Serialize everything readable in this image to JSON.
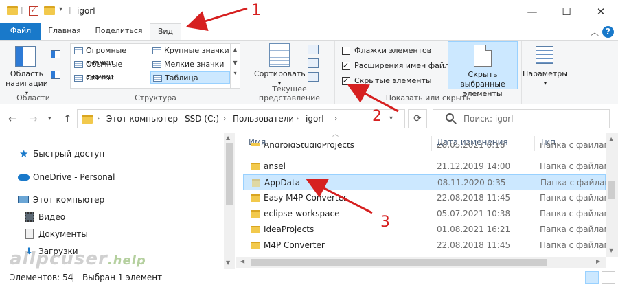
{
  "window": {
    "title": "igorl",
    "minimize": "—",
    "maximize": "☐",
    "close": "✕"
  },
  "tabs": [
    {
      "label": "Файл"
    },
    {
      "label": "Главная"
    },
    {
      "label": "Поделиться"
    },
    {
      "label": "Вид"
    }
  ],
  "help_label": "?",
  "ribbon": {
    "areas": {
      "nav_pane_label_1": "Область",
      "nav_pane_label_2": "навигации",
      "group_label": "Области"
    },
    "layout": {
      "items": [
        "Огромные значки",
        "Крупные значки",
        "Обычные значки",
        "Мелкие значки",
        "Список",
        "Таблица"
      ],
      "selected": "Таблица",
      "group_label": "Структура"
    },
    "current_view": {
      "sort_label": "Сортировать",
      "group_label": "Текущее представление"
    },
    "show_hide": {
      "checkboxes": [
        {
          "label": "Флажки элементов",
          "checked": false
        },
        {
          "label": "Расширения имен файлов",
          "checked": true
        },
        {
          "label": "Скрытые элементы",
          "checked": true
        }
      ],
      "hide_selected_1": "Скрыть выбранные",
      "hide_selected_2": "элементы",
      "group_label": "Показать или скрыть"
    },
    "options_label": "Параметры"
  },
  "address": {
    "crumbs": [
      "Этот компьютер",
      "SSD (C:)",
      "Пользователи",
      "igorl"
    ],
    "search_placeholder": "Поиск: igorl"
  },
  "nav_pane": {
    "items": [
      "Быстрый доступ",
      "OneDrive - Personal",
      "Этот компьютер",
      "Видео",
      "Документы",
      "Загрузки"
    ]
  },
  "file_list": {
    "columns": {
      "name": "Имя",
      "date": "Дата изменения",
      "type": "Тип"
    },
    "rows": [
      {
        "name": "AndroidStudioProjects",
        "date": "28.05.2021 0:18",
        "type": "Папка с файлами",
        "hidden": false,
        "selected": false
      },
      {
        "name": "ansel",
        "date": "21.12.2019 14:00",
        "type": "Папка с файлами",
        "hidden": false,
        "selected": false
      },
      {
        "name": "AppData",
        "date": "08.11.2020 0:35",
        "type": "Папка с файлами",
        "hidden": true,
        "selected": true
      },
      {
        "name": "Easy M4P Converter",
        "date": "22.08.2018 11:45",
        "type": "Папка с файлами",
        "hidden": false,
        "selected": false
      },
      {
        "name": "eclipse-workspace",
        "date": "05.07.2021 10:38",
        "type": "Папка с файлами",
        "hidden": false,
        "selected": false
      },
      {
        "name": "IdeaProjects",
        "date": "01.08.2021 16:21",
        "type": "Папка с файлами",
        "hidden": false,
        "selected": false
      },
      {
        "name": "M4P Converter",
        "date": "22.08.2018 11:45",
        "type": "Папка с файлами",
        "hidden": false,
        "selected": false
      }
    ]
  },
  "status": {
    "items_count": "Элементов: 54",
    "selected": "Выбран 1 элемент"
  },
  "annotations": {
    "n1": "1",
    "n2": "2",
    "n3": "3",
    "color": "#d62020"
  },
  "watermark": {
    "main": "allpcuser",
    "suffix": ".help"
  },
  "colors": {
    "file_tab": "#1979ca",
    "selection": "#cce8ff",
    "selection_border": "#99d1ff"
  }
}
